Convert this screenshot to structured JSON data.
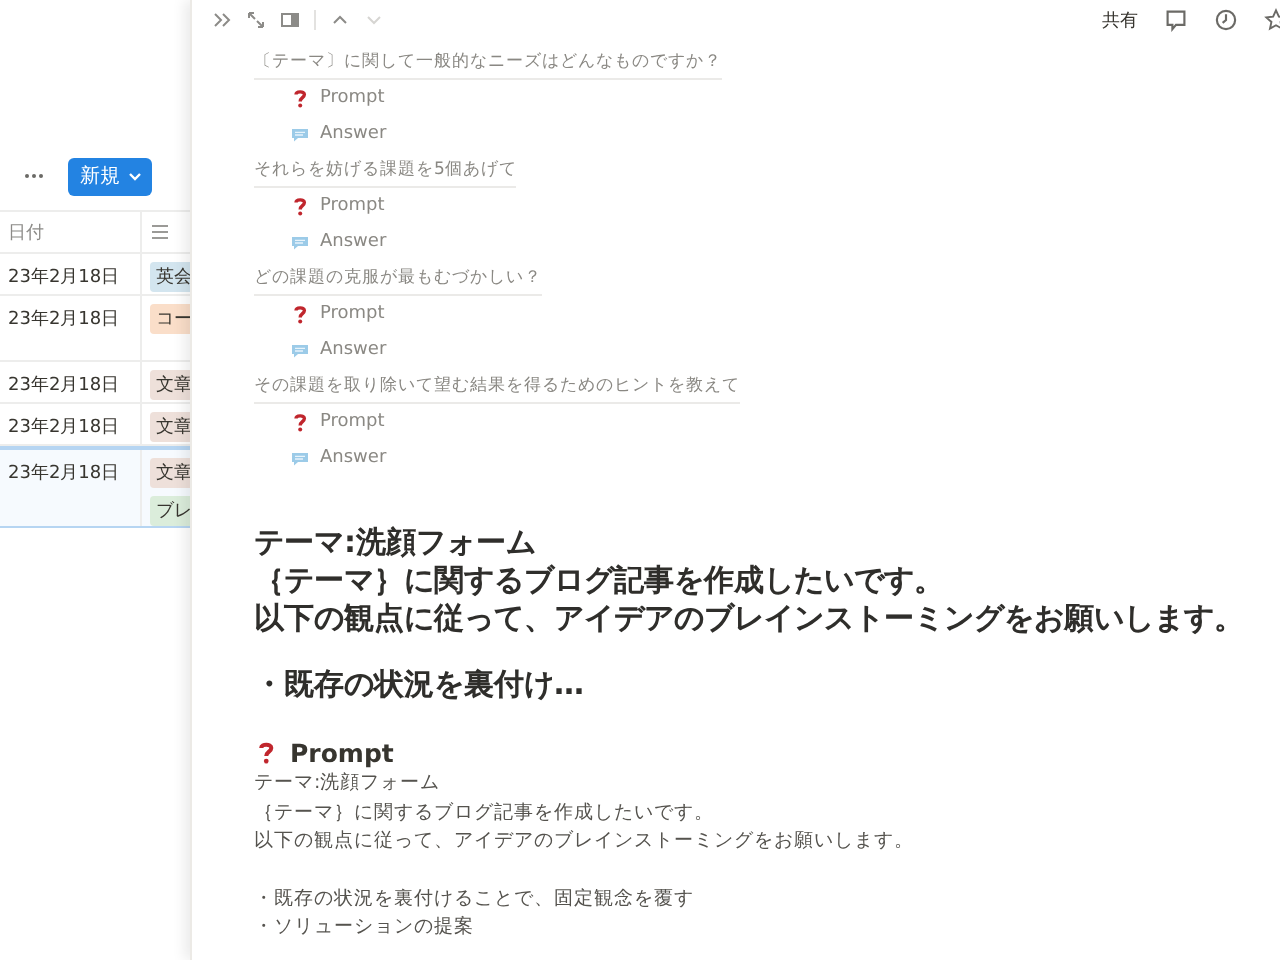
{
  "database": {
    "new_button": "新規",
    "columns": [
      "日付"
    ],
    "rows": [
      {
        "date": "23年2月18日",
        "tags": [
          {
            "label": "英会",
            "color": "#d3e5ef"
          }
        ],
        "selected": false
      },
      {
        "date": "23年2月18日",
        "tags": [
          {
            "label": "コー",
            "color": "#fadec9"
          }
        ],
        "selected": false
      },
      {
        "date": "23年2月18日",
        "tags": [
          {
            "label": "文章",
            "color": "#eee0da"
          }
        ],
        "selected": false
      },
      {
        "date": "23年2月18日",
        "tags": [
          {
            "label": "文章",
            "color": "#eee0da"
          }
        ],
        "selected": false
      },
      {
        "date": "23年2月18日",
        "tags": [
          {
            "label": "文章",
            "color": "#eee0da"
          },
          {
            "label": "ブレ",
            "color": "#dbeddb"
          }
        ],
        "selected": true
      }
    ]
  },
  "peek": {
    "toolbar": {
      "share": "共有",
      "next_disabled": true
    },
    "sections": [
      {
        "question": "〔テーマ〕に関して一般的なニーズはどんなものですか？",
        "items": [
          {
            "kind": "prompt",
            "label": "Prompt"
          },
          {
            "kind": "answer",
            "label": "Answer"
          }
        ]
      },
      {
        "question": "それらを妨げる課題を5個あげて",
        "items": [
          {
            "kind": "prompt",
            "label": "Prompt"
          },
          {
            "kind": "answer",
            "label": "Answer"
          }
        ]
      },
      {
        "question": "どの課題の克服が最もむづかしい？",
        "items": [
          {
            "kind": "prompt",
            "label": "Prompt"
          },
          {
            "kind": "answer",
            "label": "Answer"
          }
        ]
      },
      {
        "question": "その課題を取り除いて望む結果を得るためのヒントを教えて",
        "items": [
          {
            "kind": "prompt",
            "label": "Prompt"
          },
          {
            "kind": "answer",
            "label": "Answer"
          }
        ]
      }
    ],
    "heading_paragraphs": [
      [
        "テーマ:洗顔フォーム",
        "｛テーマ｝に関するブログ記事を作成したいです。",
        "以下の観点に従って、アイデアのブレインストーミングをお願いします。"
      ],
      [
        "・既存の状況を裏付け…"
      ]
    ],
    "prompt_title": "Prompt",
    "body_paragraphs": [
      [
        "テーマ:洗顔フォーム",
        "｛テーマ｝に関するブログ記事を作成したいです。",
        "以下の観点に従って、アイデアのブレインストーミングをお願いします。"
      ],
      [
        "・既存の状況を裏付けることで、固定観念を覆す",
        "・ソリューションの提案"
      ]
    ]
  }
}
